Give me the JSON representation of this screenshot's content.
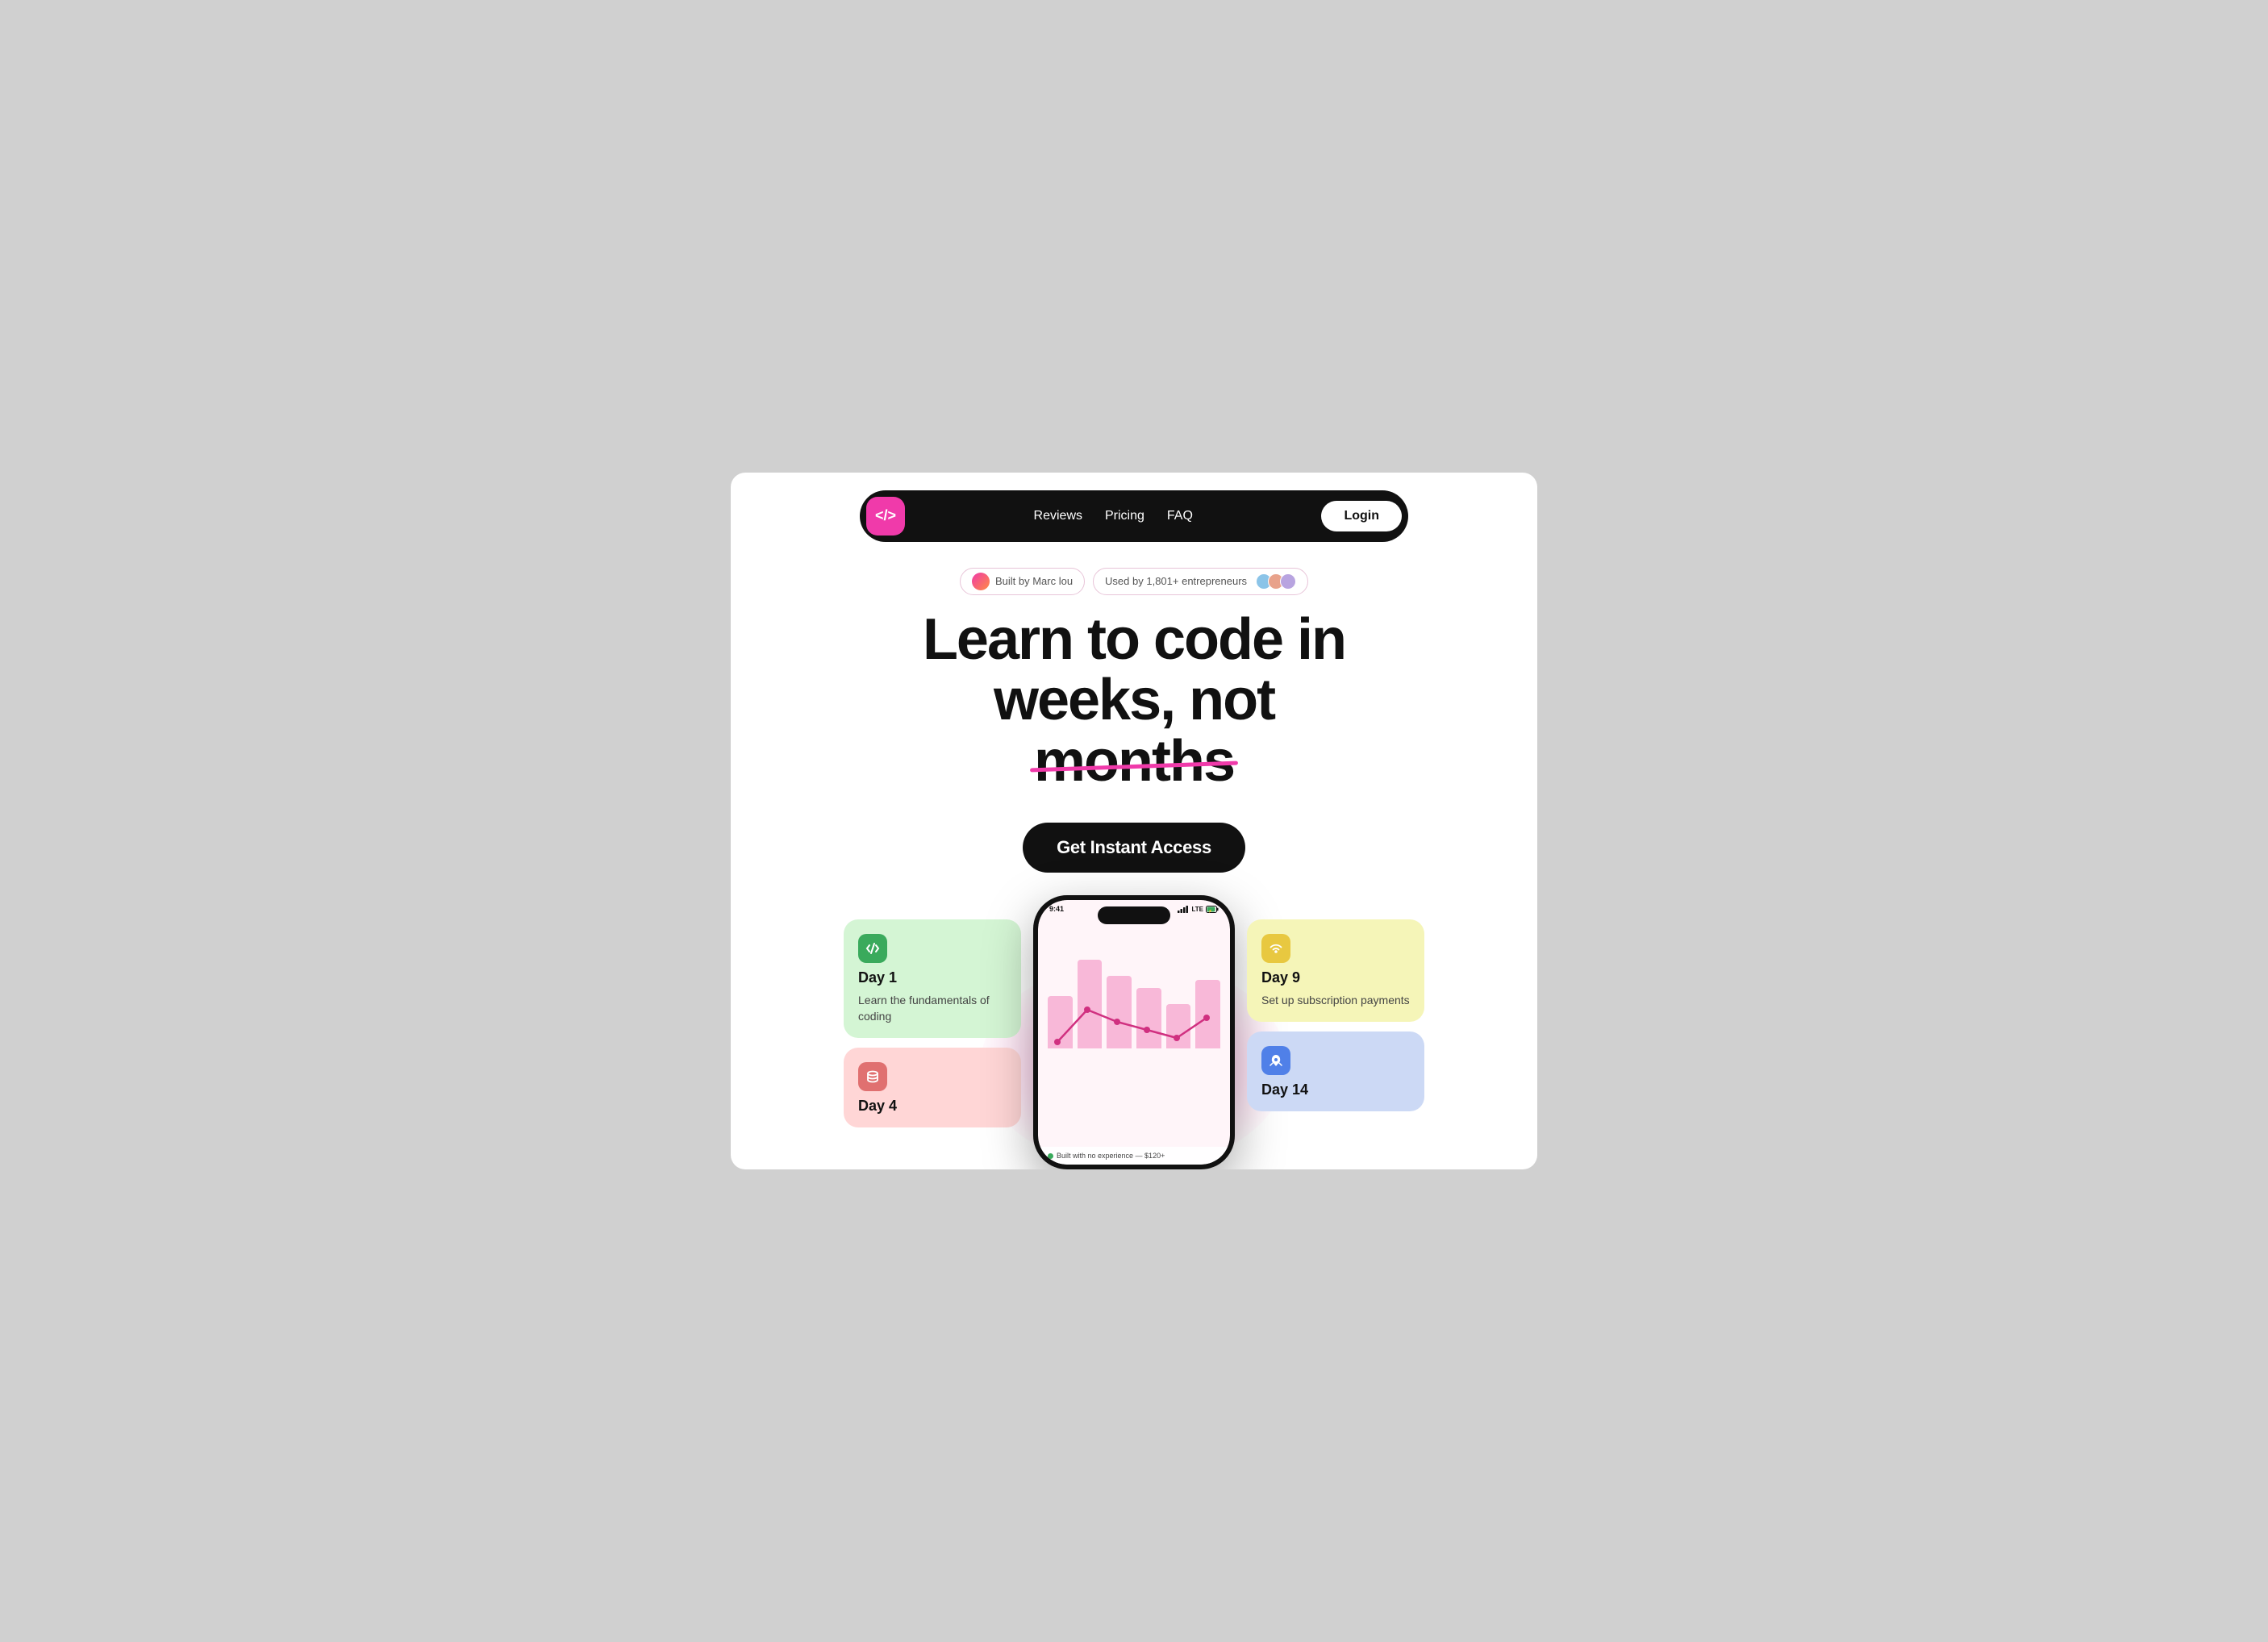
{
  "nav": {
    "logo_text": "</>",
    "links": [
      {
        "label": "Reviews",
        "id": "reviews"
      },
      {
        "label": "Pricing",
        "id": "pricing"
      },
      {
        "label": "FAQ",
        "id": "faq"
      }
    ],
    "login_label": "Login"
  },
  "badges": {
    "built_by": "Built by Marc lou",
    "used_by": "Used by 1,801+ entrepreneurs"
  },
  "hero": {
    "line1": "Learn to code in",
    "line2": "weeks, not",
    "strikethrough": "months"
  },
  "cta": {
    "label": "Get Instant Access"
  },
  "cards": [
    {
      "id": "day1",
      "day": "Day 1",
      "desc": "Learn the fundamentals of coding",
      "color": "green",
      "icon": "code"
    },
    {
      "id": "day4",
      "day": "Day 4",
      "desc": "",
      "color": "pink",
      "icon": "database"
    },
    {
      "id": "day9",
      "day": "Day 9",
      "desc": "Set up subscription payments",
      "color": "yellow",
      "icon": "wifi"
    },
    {
      "id": "day14",
      "day": "Day 14",
      "desc": "",
      "color": "blue",
      "icon": "rocket"
    }
  ],
  "phone": {
    "time": "9:41",
    "signal": "LTE",
    "bottom_label": "Built with no experience — $120+"
  },
  "chart_bars": [
    {
      "height": 65
    },
    {
      "height": 110
    },
    {
      "height": 90
    },
    {
      "height": 75
    },
    {
      "height": 55
    },
    {
      "height": 85
    }
  ]
}
